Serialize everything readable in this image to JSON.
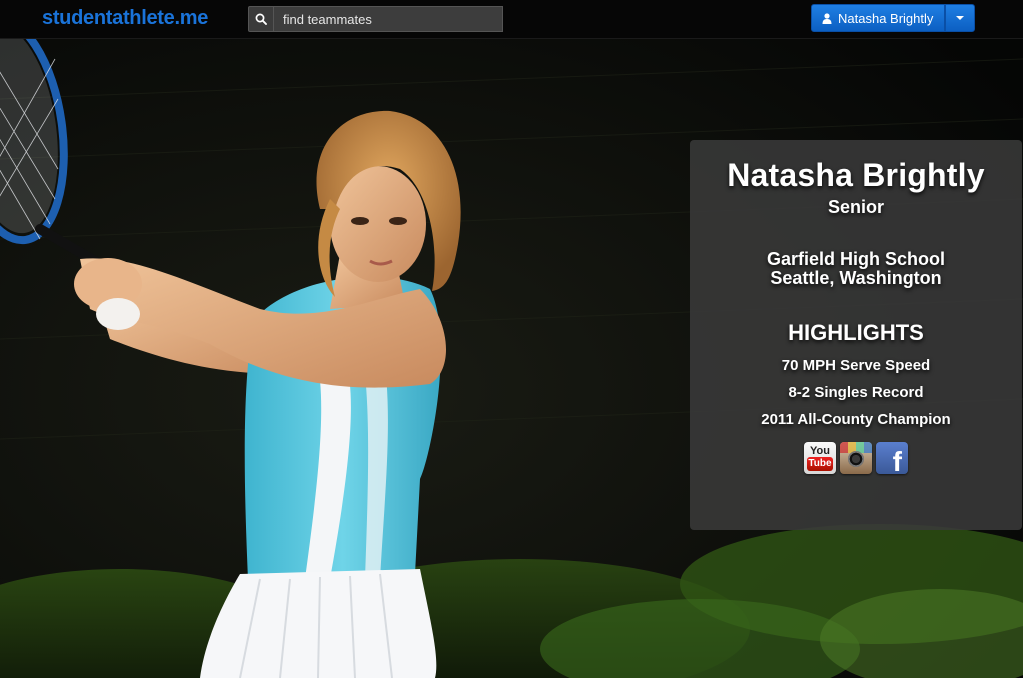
{
  "header": {
    "brand": "studentathlete.me",
    "search": {
      "placeholder": "find teammates",
      "value": ""
    },
    "user_button_label": "Natasha Brightly"
  },
  "profile": {
    "name": "Natasha Brightly",
    "class_year": "Senior",
    "school": "Garfield High School",
    "location": "Seattle, Washington",
    "highlights_heading": "HIGHLIGHTS",
    "highlights": [
      "70 MPH Serve Speed",
      "8-2 Singles Record",
      "2011 All-County Champion"
    ],
    "social": {
      "youtube_top": "You",
      "youtube_bottom": "Tube",
      "facebook_letter": "f"
    }
  },
  "icons": [
    "search-icon",
    "user-icon",
    "chevron-down-icon",
    "youtube-icon",
    "instagram-icon",
    "facebook-icon"
  ],
  "colors": {
    "brand_blue": "#1a73d9",
    "button_blue": "#0c5fc2",
    "card_bg": "#3a3a3a",
    "shirt_cyan": "#5ec8de"
  }
}
